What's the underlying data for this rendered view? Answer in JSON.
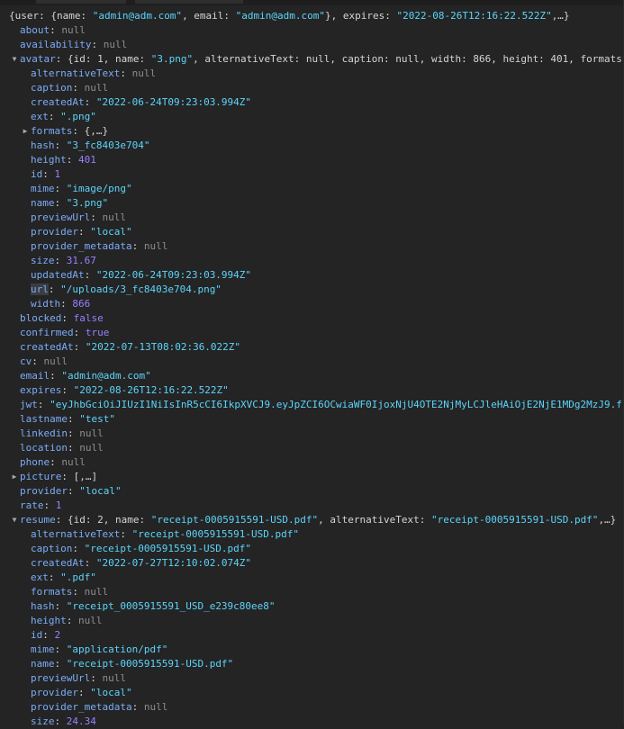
{
  "theme": {
    "bg": "#242424",
    "key": "#7cacf8",
    "string": "#5cd5fb",
    "number": "#9980ff",
    "null": "#8e8e8e",
    "punct": "#d5d5d5"
  },
  "icons": {
    "expanded": "triangle-down-icon",
    "collapsed": "triangle-right-icon"
  },
  "rows": [
    {
      "level": 0,
      "toggle": "",
      "parts": [
        [
          "p",
          "{user: {name: "
        ],
        [
          "s",
          "\"admin@adm.com\""
        ],
        [
          "p",
          ", email: "
        ],
        [
          "s",
          "\"admin@adm.com\""
        ],
        [
          "p",
          "}, expires: "
        ],
        [
          "s",
          "\"2022-08-26T12:16:22.522Z\""
        ],
        [
          "p",
          ",…}"
        ]
      ]
    },
    {
      "level": 1,
      "toggle": "",
      "parts": [
        [
          "k",
          "about"
        ],
        [
          "p",
          ": "
        ],
        [
          "nl",
          "null"
        ]
      ]
    },
    {
      "level": 1,
      "toggle": "",
      "parts": [
        [
          "k",
          "availability"
        ],
        [
          "p",
          ": "
        ],
        [
          "nl",
          "null"
        ]
      ]
    },
    {
      "level": 1,
      "toggle": "open",
      "parts": [
        [
          "k",
          "avatar"
        ],
        [
          "p",
          ": {id: 1, name: "
        ],
        [
          "s",
          "\"3.png\""
        ],
        [
          "p",
          ", alternativeText: null, caption: null, width: 866, height: 401, formats"
        ]
      ]
    },
    {
      "level": 2,
      "toggle": "",
      "parts": [
        [
          "k",
          "alternativeText"
        ],
        [
          "p",
          ": "
        ],
        [
          "nl",
          "null"
        ]
      ]
    },
    {
      "level": 2,
      "toggle": "",
      "parts": [
        [
          "k",
          "caption"
        ],
        [
          "p",
          ": "
        ],
        [
          "nl",
          "null"
        ]
      ]
    },
    {
      "level": 2,
      "toggle": "",
      "parts": [
        [
          "k",
          "createdAt"
        ],
        [
          "p",
          ": "
        ],
        [
          "s",
          "\"2022-06-24T09:23:03.994Z\""
        ]
      ]
    },
    {
      "level": 2,
      "toggle": "",
      "parts": [
        [
          "k",
          "ext"
        ],
        [
          "p",
          ": "
        ],
        [
          "s",
          "\".png\""
        ]
      ]
    },
    {
      "level": 2,
      "toggle": "closed",
      "parts": [
        [
          "k",
          "formats"
        ],
        [
          "p",
          ": {,…}"
        ]
      ]
    },
    {
      "level": 2,
      "toggle": "",
      "parts": [
        [
          "k",
          "hash"
        ],
        [
          "p",
          ": "
        ],
        [
          "s",
          "\"3_fc8403e704\""
        ]
      ]
    },
    {
      "level": 2,
      "toggle": "",
      "parts": [
        [
          "k",
          "height"
        ],
        [
          "p",
          ": "
        ],
        [
          "n",
          "401"
        ]
      ]
    },
    {
      "level": 2,
      "toggle": "",
      "parts": [
        [
          "k",
          "id"
        ],
        [
          "p",
          ": "
        ],
        [
          "n",
          "1"
        ]
      ]
    },
    {
      "level": 2,
      "toggle": "",
      "parts": [
        [
          "k",
          "mime"
        ],
        [
          "p",
          ": "
        ],
        [
          "s",
          "\"image/png\""
        ]
      ]
    },
    {
      "level": 2,
      "toggle": "",
      "parts": [
        [
          "k",
          "name"
        ],
        [
          "p",
          ": "
        ],
        [
          "s",
          "\"3.png\""
        ]
      ]
    },
    {
      "level": 2,
      "toggle": "",
      "parts": [
        [
          "k",
          "previewUrl"
        ],
        [
          "p",
          ": "
        ],
        [
          "nl",
          "null"
        ]
      ]
    },
    {
      "level": 2,
      "toggle": "",
      "parts": [
        [
          "k",
          "provider"
        ],
        [
          "p",
          ": "
        ],
        [
          "s",
          "\"local\""
        ]
      ]
    },
    {
      "level": 2,
      "toggle": "",
      "parts": [
        [
          "k",
          "provider_metadata"
        ],
        [
          "p",
          ": "
        ],
        [
          "nl",
          "null"
        ]
      ]
    },
    {
      "level": 2,
      "toggle": "",
      "parts": [
        [
          "k",
          "size"
        ],
        [
          "p",
          ": "
        ],
        [
          "n",
          "31.67"
        ]
      ]
    },
    {
      "level": 2,
      "toggle": "",
      "parts": [
        [
          "k",
          "updatedAt"
        ],
        [
          "p",
          ": "
        ],
        [
          "s",
          "\"2022-06-24T09:23:03.994Z\""
        ]
      ]
    },
    {
      "level": 2,
      "toggle": "",
      "parts": [
        [
          "k hl",
          "url"
        ],
        [
          "p",
          ": "
        ],
        [
          "s",
          "\"/uploads/3_fc8403e704.png\""
        ]
      ]
    },
    {
      "level": 2,
      "toggle": "",
      "parts": [
        [
          "k",
          "width"
        ],
        [
          "p",
          ": "
        ],
        [
          "n",
          "866"
        ]
      ]
    },
    {
      "level": 1,
      "toggle": "",
      "parts": [
        [
          "k",
          "blocked"
        ],
        [
          "p",
          ": "
        ],
        [
          "b",
          "false"
        ]
      ]
    },
    {
      "level": 1,
      "toggle": "",
      "parts": [
        [
          "k",
          "confirmed"
        ],
        [
          "p",
          ": "
        ],
        [
          "b",
          "true"
        ]
      ]
    },
    {
      "level": 1,
      "toggle": "",
      "parts": [
        [
          "k",
          "createdAt"
        ],
        [
          "p",
          ": "
        ],
        [
          "s",
          "\"2022-07-13T08:02:36.022Z\""
        ]
      ]
    },
    {
      "level": 1,
      "toggle": "",
      "parts": [
        [
          "k",
          "cv"
        ],
        [
          "p",
          ": "
        ],
        [
          "nl",
          "null"
        ]
      ]
    },
    {
      "level": 1,
      "toggle": "",
      "parts": [
        [
          "k",
          "email"
        ],
        [
          "p",
          ": "
        ],
        [
          "s",
          "\"admin@adm.com\""
        ]
      ]
    },
    {
      "level": 1,
      "toggle": "",
      "parts": [
        [
          "k",
          "expires"
        ],
        [
          "p",
          ": "
        ],
        [
          "s",
          "\"2022-08-26T12:16:22.522Z\""
        ]
      ]
    },
    {
      "level": 1,
      "toggle": "",
      "parts": [
        [
          "k",
          "jwt"
        ],
        [
          "p",
          ": "
        ],
        [
          "s",
          "\"eyJhbGciOiJIUzI1NiIsInR5cCI6IkpXVCJ9.eyJpZCI6OCwiaWF0IjoxNjU4OTE2NjMyLCJleHAiOjE2NjE1MDg2MzJ9.f"
        ]
      ]
    },
    {
      "level": 1,
      "toggle": "",
      "parts": [
        [
          "k",
          "lastname"
        ],
        [
          "p",
          ": "
        ],
        [
          "s",
          "\"test\""
        ]
      ]
    },
    {
      "level": 1,
      "toggle": "",
      "parts": [
        [
          "k",
          "linkedin"
        ],
        [
          "p",
          ": "
        ],
        [
          "nl",
          "null"
        ]
      ]
    },
    {
      "level": 1,
      "toggle": "",
      "parts": [
        [
          "k",
          "location"
        ],
        [
          "p",
          ": "
        ],
        [
          "nl",
          "null"
        ]
      ]
    },
    {
      "level": 1,
      "toggle": "",
      "parts": [
        [
          "k",
          "phone"
        ],
        [
          "p",
          ": "
        ],
        [
          "nl",
          "null"
        ]
      ]
    },
    {
      "level": 1,
      "toggle": "closed",
      "parts": [
        [
          "k",
          "picture"
        ],
        [
          "p",
          ": [,…]"
        ]
      ]
    },
    {
      "level": 1,
      "toggle": "",
      "parts": [
        [
          "k",
          "provider"
        ],
        [
          "p",
          ": "
        ],
        [
          "s",
          "\"local\""
        ]
      ]
    },
    {
      "level": 1,
      "toggle": "",
      "parts": [
        [
          "k",
          "rate"
        ],
        [
          "p",
          ": "
        ],
        [
          "n",
          "1"
        ]
      ]
    },
    {
      "level": 1,
      "toggle": "open",
      "parts": [
        [
          "k",
          "resume"
        ],
        [
          "p",
          ": {id: 2, name: "
        ],
        [
          "s",
          "\"receipt-0005915591-USD.pdf\""
        ],
        [
          "p",
          ", alternativeText: "
        ],
        [
          "s",
          "\"receipt-0005915591-USD.pdf\""
        ],
        [
          "p",
          ",…}"
        ]
      ]
    },
    {
      "level": 2,
      "toggle": "",
      "parts": [
        [
          "k",
          "alternativeText"
        ],
        [
          "p",
          ": "
        ],
        [
          "s",
          "\"receipt-0005915591-USD.pdf\""
        ]
      ]
    },
    {
      "level": 2,
      "toggle": "",
      "parts": [
        [
          "k",
          "caption"
        ],
        [
          "p",
          ": "
        ],
        [
          "s",
          "\"receipt-0005915591-USD.pdf\""
        ]
      ]
    },
    {
      "level": 2,
      "toggle": "",
      "parts": [
        [
          "k",
          "createdAt"
        ],
        [
          "p",
          ": "
        ],
        [
          "s",
          "\"2022-07-27T12:10:02.074Z\""
        ]
      ]
    },
    {
      "level": 2,
      "toggle": "",
      "parts": [
        [
          "k",
          "ext"
        ],
        [
          "p",
          ": "
        ],
        [
          "s",
          "\".pdf\""
        ]
      ]
    },
    {
      "level": 2,
      "toggle": "",
      "parts": [
        [
          "k",
          "formats"
        ],
        [
          "p",
          ": "
        ],
        [
          "nl",
          "null"
        ]
      ]
    },
    {
      "level": 2,
      "toggle": "",
      "parts": [
        [
          "k",
          "hash"
        ],
        [
          "p",
          ": "
        ],
        [
          "s",
          "\"receipt_0005915591_USD_e239c80ee8\""
        ]
      ]
    },
    {
      "level": 2,
      "toggle": "",
      "parts": [
        [
          "k",
          "height"
        ],
        [
          "p",
          ": "
        ],
        [
          "nl",
          "null"
        ]
      ]
    },
    {
      "level": 2,
      "toggle": "",
      "parts": [
        [
          "k",
          "id"
        ],
        [
          "p",
          ": "
        ],
        [
          "n",
          "2"
        ]
      ]
    },
    {
      "level": 2,
      "toggle": "",
      "parts": [
        [
          "k",
          "mime"
        ],
        [
          "p",
          ": "
        ],
        [
          "s",
          "\"application/pdf\""
        ]
      ]
    },
    {
      "level": 2,
      "toggle": "",
      "parts": [
        [
          "k",
          "name"
        ],
        [
          "p",
          ": "
        ],
        [
          "s",
          "\"receipt-0005915591-USD.pdf\""
        ]
      ]
    },
    {
      "level": 2,
      "toggle": "",
      "parts": [
        [
          "k",
          "previewUrl"
        ],
        [
          "p",
          ": "
        ],
        [
          "nl",
          "null"
        ]
      ]
    },
    {
      "level": 2,
      "toggle": "",
      "parts": [
        [
          "k",
          "provider"
        ],
        [
          "p",
          ": "
        ],
        [
          "s",
          "\"local\""
        ]
      ]
    },
    {
      "level": 2,
      "toggle": "",
      "parts": [
        [
          "k",
          "provider_metadata"
        ],
        [
          "p",
          ": "
        ],
        [
          "nl",
          "null"
        ]
      ]
    },
    {
      "level": 2,
      "toggle": "",
      "parts": [
        [
          "k",
          "size"
        ],
        [
          "p",
          ": "
        ],
        [
          "n",
          "24.34"
        ]
      ]
    }
  ]
}
